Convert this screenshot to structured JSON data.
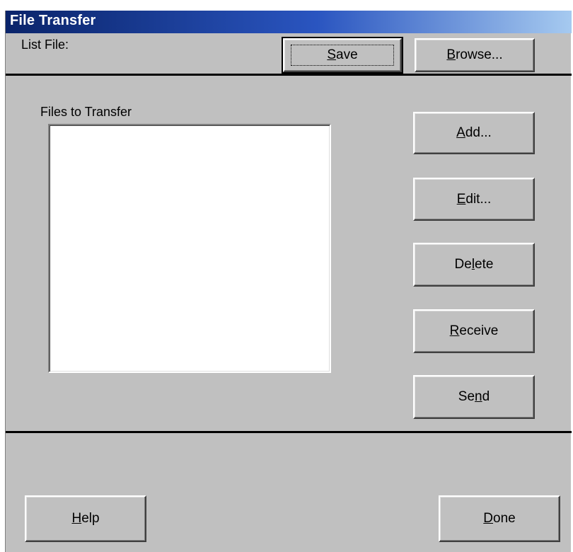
{
  "window": {
    "title": "File Transfer"
  },
  "top": {
    "list_file_label": "List File:",
    "save_pre": "",
    "save_key": "S",
    "save_post": "ave",
    "browse_pre": "",
    "browse_key": "B",
    "browse_post": "rowse..."
  },
  "files": {
    "label": "Files to Transfer",
    "items": []
  },
  "actions": {
    "add_pre": "",
    "add_key": "A",
    "add_post": "dd...",
    "edit_pre": "",
    "edit_key": "E",
    "edit_post": "dit...",
    "delete_pre": "De",
    "delete_key": "l",
    "delete_post": "ete",
    "receive_pre": "",
    "receive_key": "R",
    "receive_post": "eceive",
    "send_pre": "Se",
    "send_key": "n",
    "send_post": "d"
  },
  "bottom": {
    "help_pre": "",
    "help_key": "H",
    "help_post": "elp",
    "done_pre": "",
    "done_key": "D",
    "done_post": "one"
  },
  "colors": {
    "face": "#c0c0c0",
    "titlebar_start": "#0a246a",
    "titlebar_end": "#a6caf0",
    "title_text": "#ffffff"
  }
}
